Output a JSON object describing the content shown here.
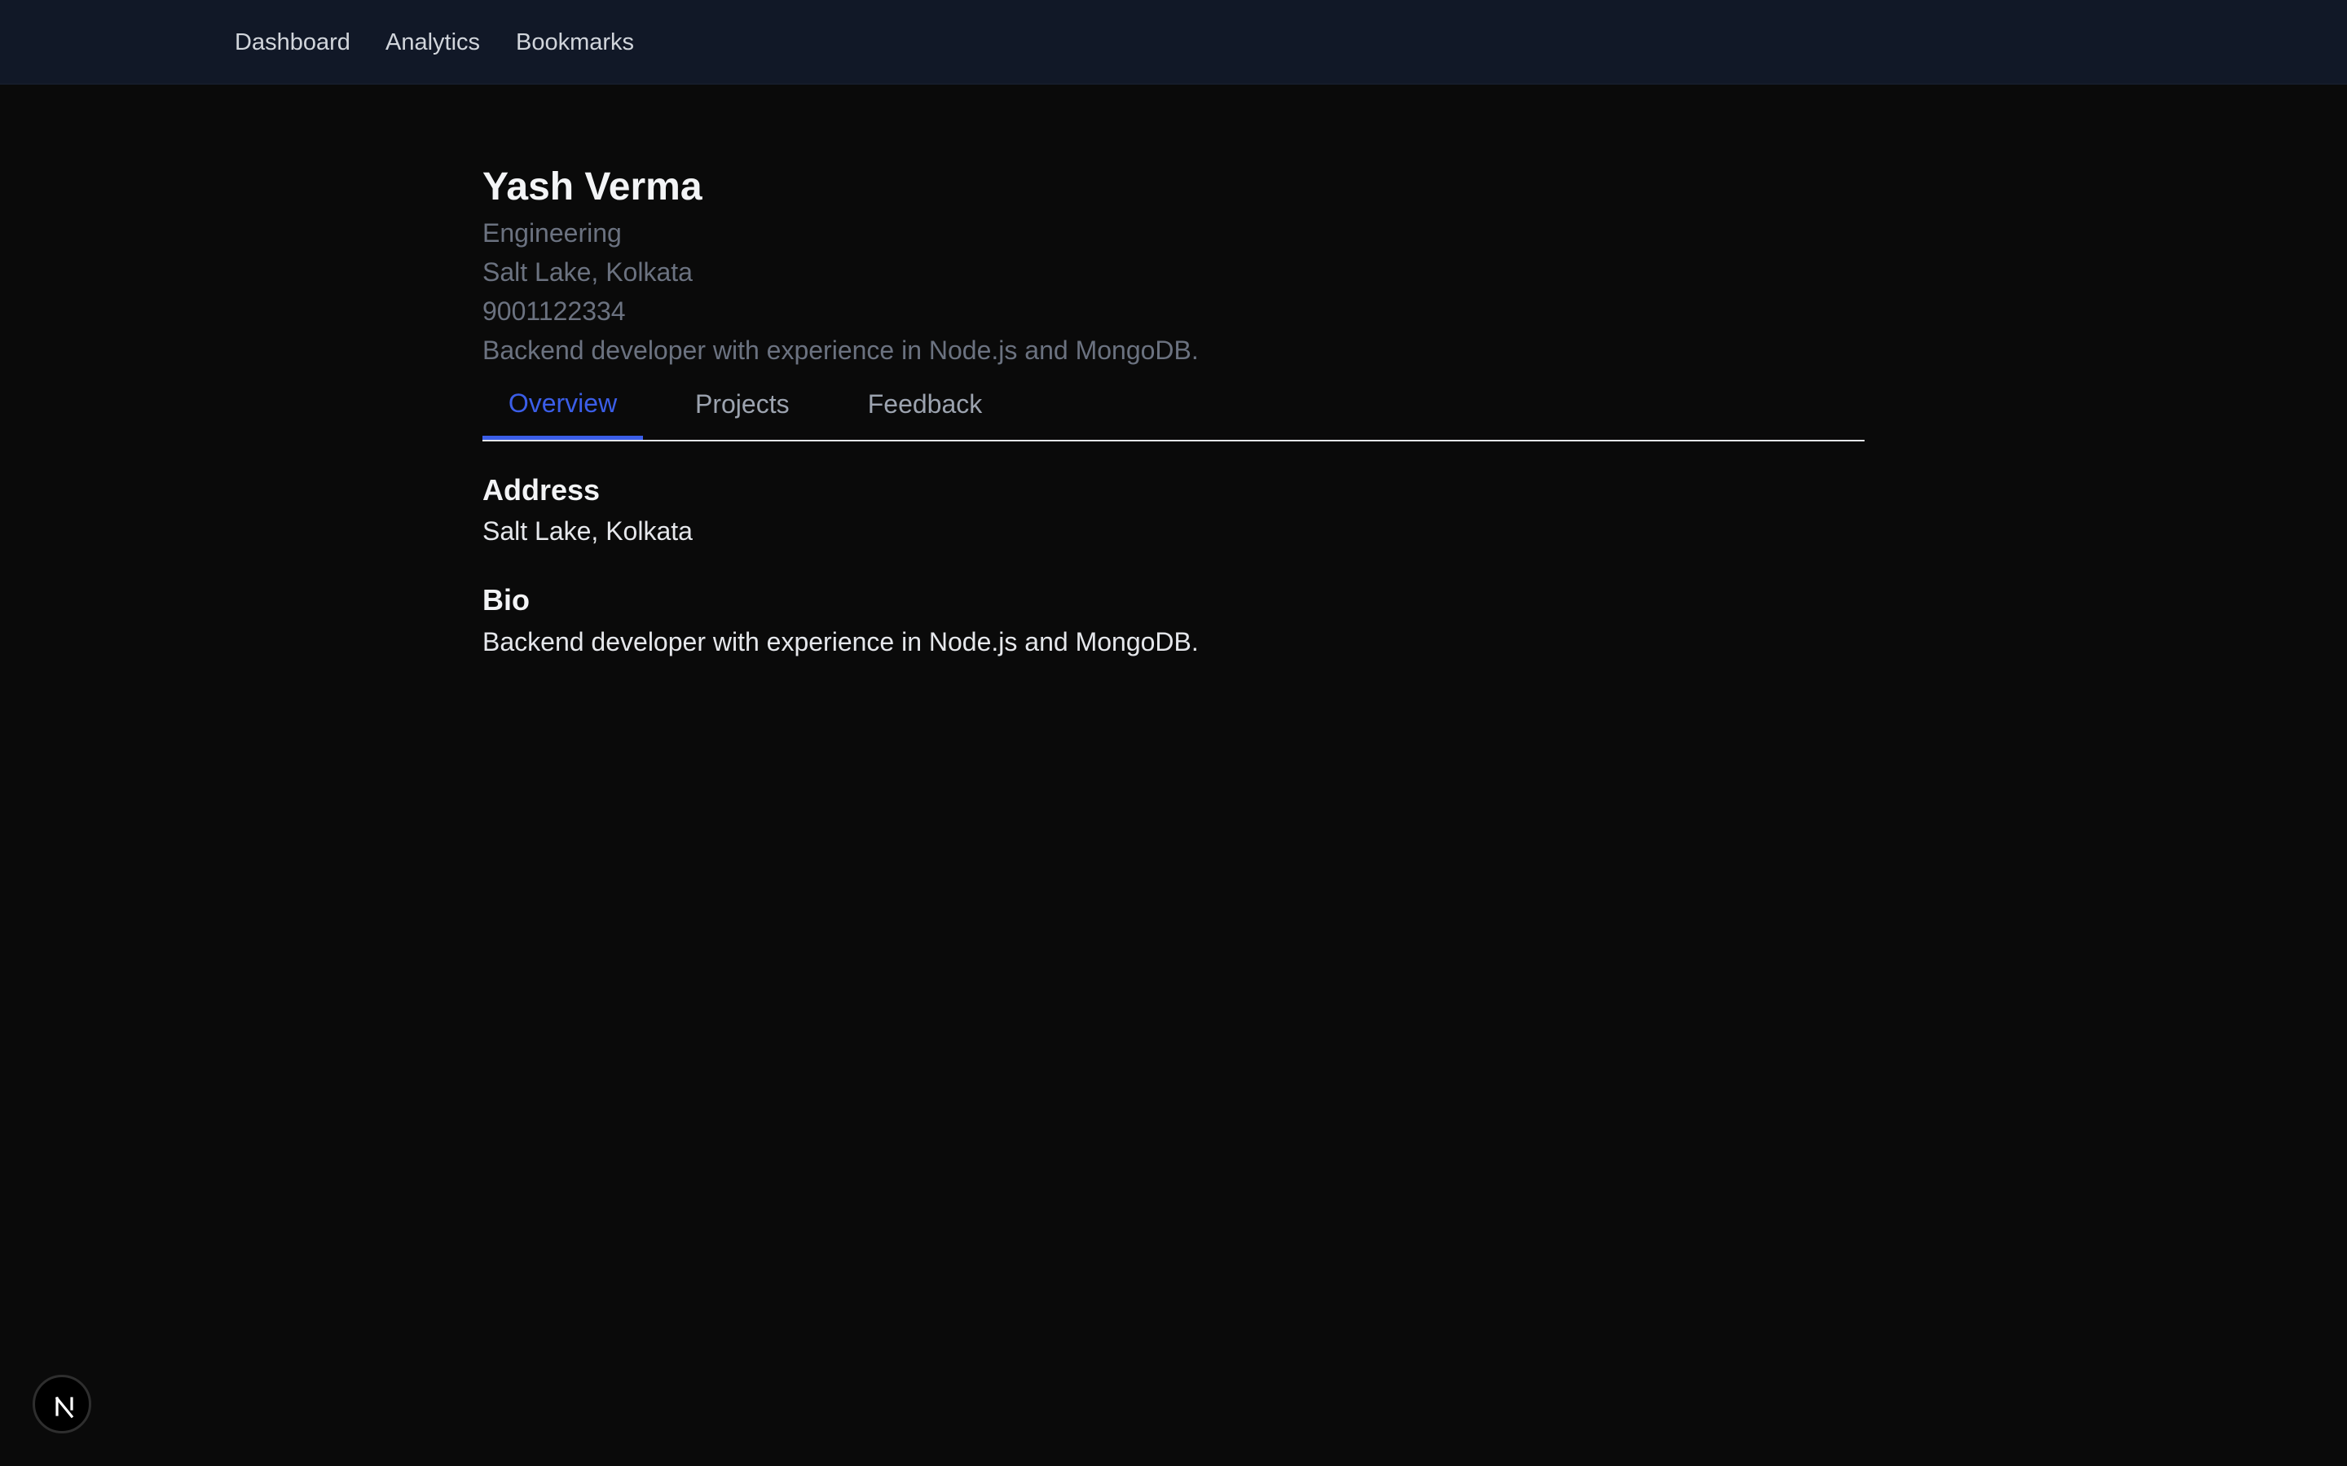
{
  "nav": {
    "items": [
      {
        "label": "Dashboard"
      },
      {
        "label": "Analytics"
      },
      {
        "label": "Bookmarks"
      }
    ]
  },
  "profile": {
    "name": "Yash Verma",
    "department": "Engineering",
    "address": "Salt Lake, Kolkata",
    "phone": "9001122334",
    "bio": "Backend developer with experience in Node.js and MongoDB."
  },
  "tabs": [
    {
      "label": "Overview",
      "active": true
    },
    {
      "label": "Projects",
      "active": false
    },
    {
      "label": "Feedback",
      "active": false
    }
  ],
  "overview": {
    "address_title": "Address",
    "address_value": "Salt Lake, Kolkata",
    "bio_title": "Bio",
    "bio_value": "Backend developer with experience in Node.js and MongoDB."
  },
  "badge": {
    "icon": "nextjs-logo-icon"
  },
  "colors": {
    "background": "#0a0a0a",
    "nav_background": "#111827",
    "accent": "#3b5ee8",
    "muted_text": "#6b7280"
  }
}
